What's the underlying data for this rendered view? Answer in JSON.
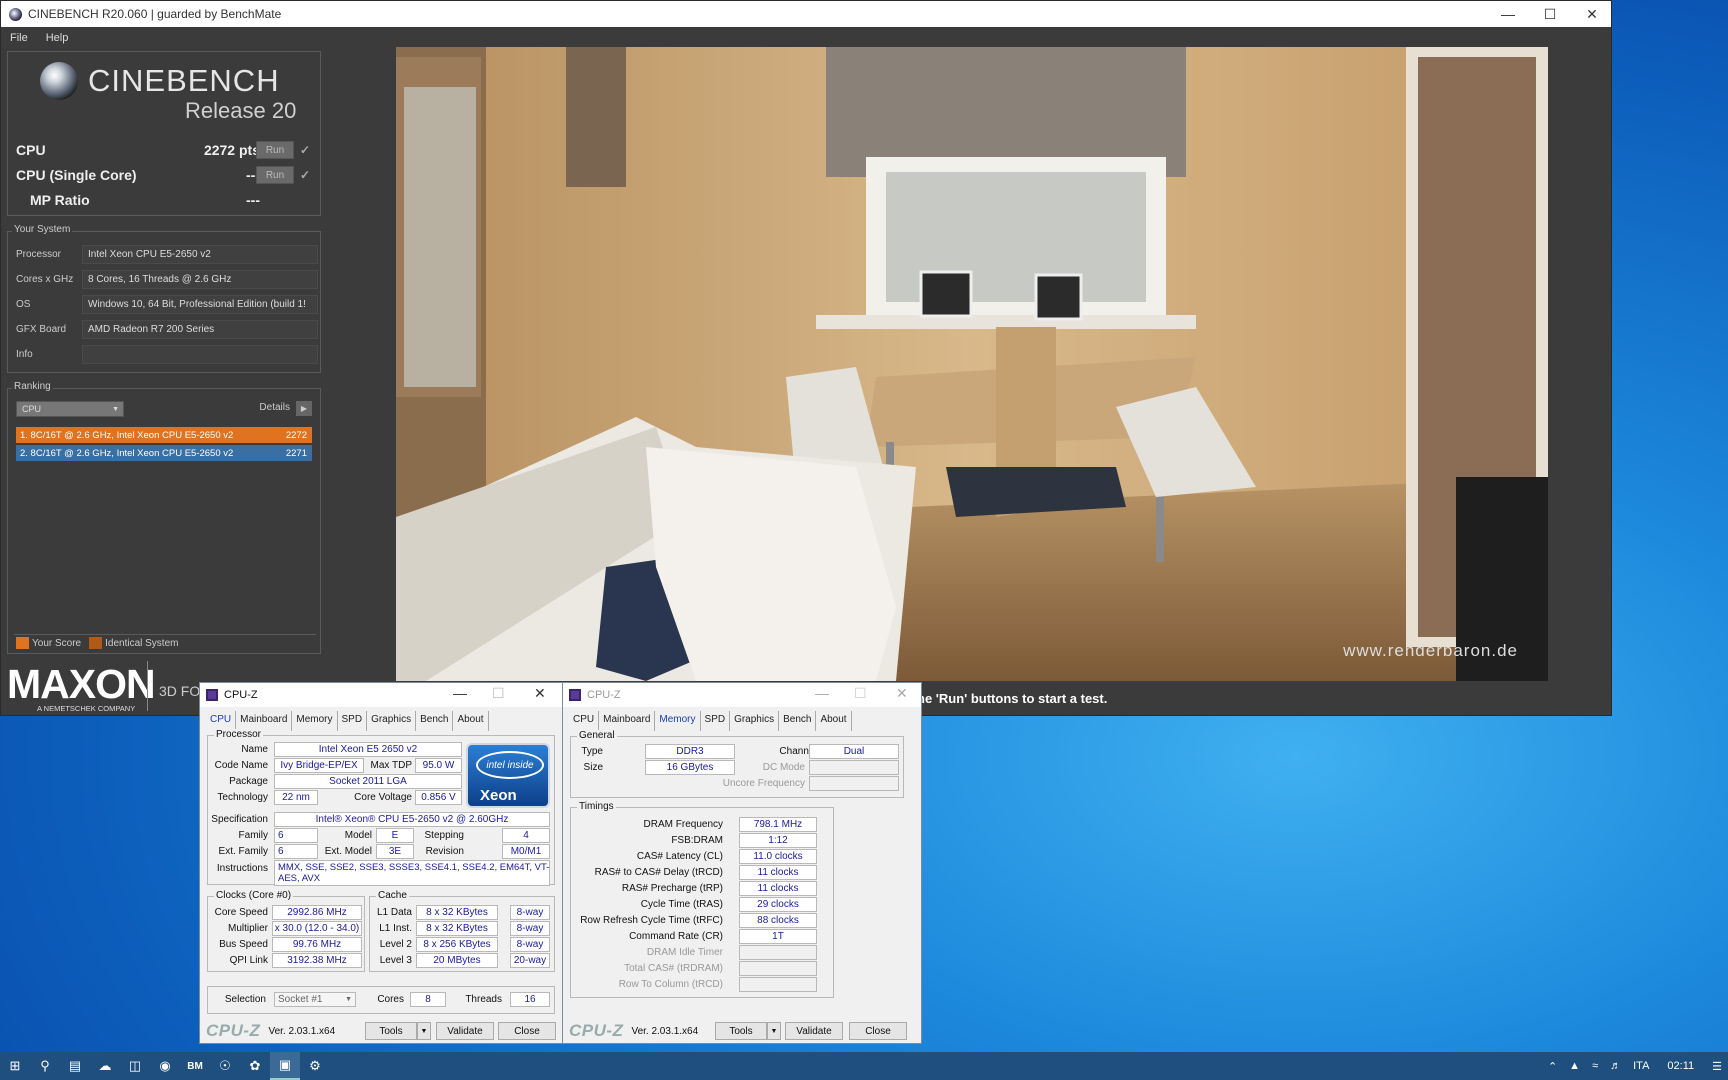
{
  "cinebench": {
    "title": "CINEBENCH R20.060 | guarded by BenchMate",
    "menu": [
      "File",
      "Help"
    ],
    "logo_text": "CINEBENCH",
    "release": "Release 20",
    "scores": [
      {
        "label": "CPU",
        "value": "2272 pts",
        "run": "Run"
      },
      {
        "label": "CPU (Single Core)",
        "value": "---",
        "run": "Run"
      },
      {
        "label": "MP Ratio",
        "value": "---"
      }
    ],
    "system": {
      "title": "Your System",
      "rows": [
        {
          "label": "Processor",
          "value": "Intel Xeon CPU E5-2650 v2"
        },
        {
          "label": "Cores x GHz",
          "value": "8 Cores, 16 Threads @ 2.6 GHz"
        },
        {
          "label": "OS",
          "value": "Windows 10, 64 Bit, Professional Edition (build 1!"
        },
        {
          "label": "GFX Board",
          "value": "AMD Radeon R7 200 Series"
        },
        {
          "label": "Info",
          "value": ""
        }
      ]
    },
    "ranking": {
      "title": "Ranking",
      "select": "CPU",
      "details": "Details",
      "rows": [
        {
          "text": "1. 8C/16T @ 2.6 GHz, Intel Xeon CPU E5-2650 v2",
          "score": "2272",
          "color": "#e0731f"
        },
        {
          "text": "2. 8C/16T @ 2.6 GHz, Intel Xeon CPU E5-2650 v2",
          "score": "2271",
          "color": "#3a6fa3"
        }
      ],
      "legend": [
        {
          "label": "Your Score",
          "color": "#e0731f"
        },
        {
          "label": "Identical System",
          "color": "#b05a1a"
        }
      ]
    },
    "maxon": "MAXON",
    "maxon_sub": "A NEMETSCHEK COMPANY",
    "fo": "3D FO",
    "hint": "he 'Run' buttons to start a test.",
    "watermark": "www.renderbaron.de"
  },
  "cpuz1": {
    "title": "CPU-Z",
    "tabs": [
      "CPU",
      "Mainboard",
      "Memory",
      "SPD",
      "Graphics",
      "Bench",
      "About"
    ],
    "selected_tab": "CPU",
    "processor_label": "Processor",
    "name_label": "Name",
    "name": "Intel Xeon E5 2650 v2",
    "codename_label": "Code Name",
    "codename": "Ivy Bridge-EP/EX",
    "maxtdp_label": "Max TDP",
    "maxtdp": "95.0 W",
    "package_label": "Package",
    "package": "Socket 2011 LGA",
    "tech_label": "Technology",
    "tech": "22 nm",
    "vcore_label": "Core Voltage",
    "vcore": "0.856 V",
    "spec_label": "Specification",
    "spec": "Intel® Xeon® CPU E5-2650 v2 @ 2.60GHz",
    "family_label": "Family",
    "family": "6",
    "model_label": "Model",
    "model": "E",
    "stepping_label": "Stepping",
    "stepping": "4",
    "extfamily_label": "Ext. Family",
    "extfamily": "6",
    "extmodel_label": "Ext. Model",
    "extmodel": "3E",
    "revision_label": "Revision",
    "revision": "M0/M1",
    "instr_label": "Instructions",
    "instr1": "MMX, SSE, SSE2, SSE3, SSSE3, SSE4.1, SSE4.2, EM64T, VT-x,",
    "instr2": "AES, AVX",
    "clocks_label": "Clocks (Core #0)",
    "corespeed_label": "Core Speed",
    "corespeed": "2992.86 MHz",
    "mult_label": "Multiplier",
    "mult": "x 30.0 (12.0 - 34.0)",
    "bus_label": "Bus Speed",
    "bus": "99.76 MHz",
    "qpi_label": "QPI Link",
    "qpi": "3192.38 MHz",
    "cache_label": "Cache",
    "l1d_label": "L1 Data",
    "l1d": "8 x 32 KBytes",
    "l1d_way": "8-way",
    "l1i_label": "L1 Inst.",
    "l1i": "8 x 32 KBytes",
    "l1i_way": "8-way",
    "l2_label": "Level 2",
    "l2": "8 x 256 KBytes",
    "l2_way": "8-way",
    "l3_label": "Level 3",
    "l3": "20 MBytes",
    "l3_way": "20-way",
    "selection_label": "Selection",
    "selection": "Socket #1",
    "cores_label": "Cores",
    "cores": "8",
    "threads_label": "Threads",
    "threads": "16",
    "logo": "CPU-Z",
    "version": "Ver. 2.03.1.x64",
    "tools": "Tools",
    "validate": "Validate",
    "close": "Close",
    "badge_top": "intel inside",
    "badge_bottom": "Xeon"
  },
  "cpuz2": {
    "title": "CPU-Z",
    "tabs": [
      "CPU",
      "Mainboard",
      "Memory",
      "SPD",
      "Graphics",
      "Bench",
      "About"
    ],
    "selected_tab": "Memory",
    "general_label": "General",
    "type_label": "Type",
    "type": "DDR3",
    "size_label": "Size",
    "size": "16 GBytes",
    "channel_label": "Channel #",
    "channel": "Dual",
    "dcmode_label": "DC Mode",
    "uncore_label": "Uncore Frequency",
    "timings_label": "Timings",
    "timings": [
      {
        "label": "DRAM Frequency",
        "value": "798.1 MHz"
      },
      {
        "label": "FSB:DRAM",
        "value": "1:12"
      },
      {
        "label": "CAS# Latency (CL)",
        "value": "11.0 clocks"
      },
      {
        "label": "RAS# to CAS# Delay (tRCD)",
        "value": "11 clocks"
      },
      {
        "label": "RAS# Precharge (tRP)",
        "value": "11 clocks"
      },
      {
        "label": "Cycle Time (tRAS)",
        "value": "29 clocks"
      },
      {
        "label": "Row Refresh Cycle Time (tRFC)",
        "value": "88 clocks"
      },
      {
        "label": "Command Rate (CR)",
        "value": "1T"
      },
      {
        "label": "DRAM Idle Timer",
        "value": ""
      },
      {
        "label": "Total CAS# (tRDRAM)",
        "value": ""
      },
      {
        "label": "Row To Column (tRCD)",
        "value": ""
      }
    ],
    "logo": "CPU-Z",
    "version": "Ver. 2.03.1.x64",
    "tools": "Tools",
    "validate": "Validate",
    "close": "Close"
  },
  "taskbar": {
    "lang": "ITA",
    "time": "02:11"
  }
}
